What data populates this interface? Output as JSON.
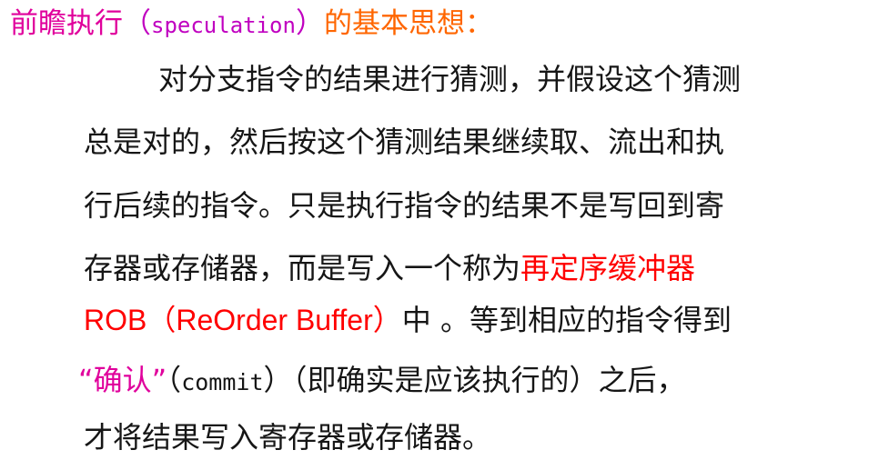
{
  "colors": {
    "heading_main": "#e0009c",
    "heading_paren": "#c000c0",
    "heading_mono": "#c000c0",
    "heading_tail": "#ff6600",
    "body": "#161616",
    "highlight_red": "#ff0000",
    "highlight_magenta": "#e0009c"
  },
  "heading": {
    "main": "前瞻执行",
    "paren_open": "（",
    "term": "speculation",
    "paren_close": "）",
    "tail": "的基本思想："
  },
  "body": {
    "line1": "对分支指令的结果进行猜测，并假设这个猜测",
    "line2": "总是对的，然后按这个猜测结果继续取、流出和执",
    "line3": "行后续的指令。只是执行指令的结果不是写回到寄",
    "line4_a": "存器或存储器，而是写入一个称为",
    "line4_b": "再定序缓冲器",
    "line5_a": "ROB",
    "line5_b": "（",
    "line5_c": "ReOrder Buffer",
    "line5_d": "）",
    "line5_e": "中 。等到相应的指令得到",
    "line6_a": "“确认”",
    "line6_b": "（",
    "line6_c": "commit",
    "line6_d": "）（即确实是应该执行的）之后，",
    "line7": "才将结果写入寄存器或存储器。"
  }
}
